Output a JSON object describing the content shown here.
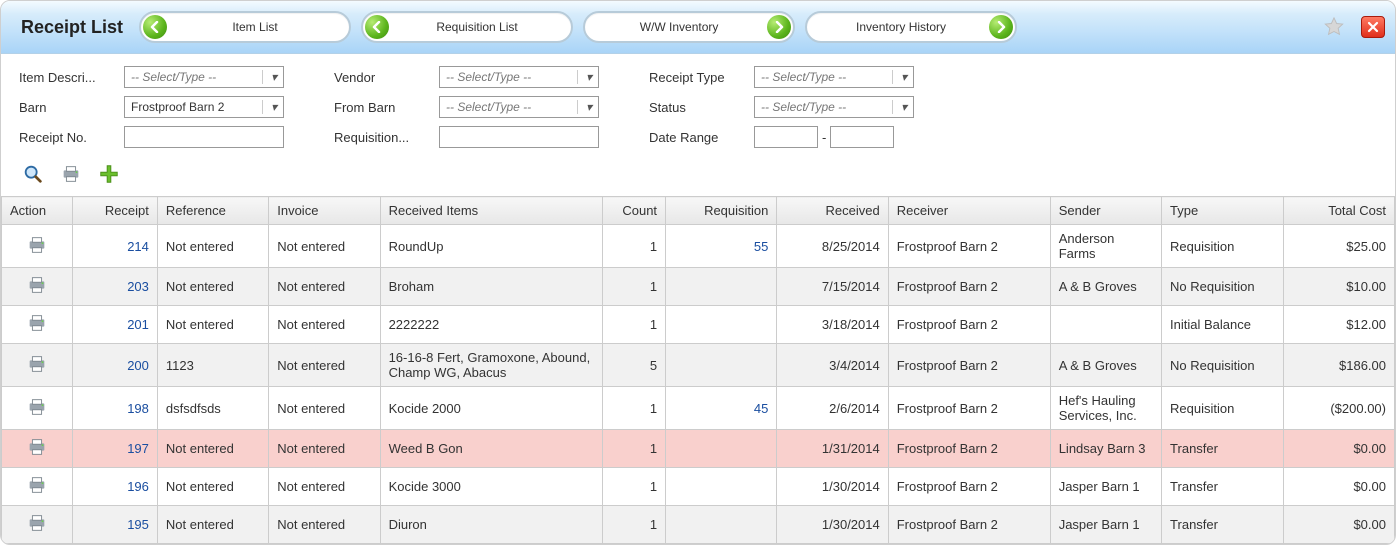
{
  "title": "Receipt List",
  "nav": {
    "item_list": "Item List",
    "requisition_list": "Requisition List",
    "ww_inventory": "W/W Inventory",
    "inventory_history": "Inventory History"
  },
  "filters": {
    "placeholder": "-- Select/Type --",
    "item_description": {
      "label": "Item Descri..."
    },
    "barn": {
      "label": "Barn",
      "value": "Frostproof Barn 2"
    },
    "receipt_no": {
      "label": "Receipt No."
    },
    "vendor": {
      "label": "Vendor"
    },
    "from_barn": {
      "label": "From Barn"
    },
    "requisition": {
      "label": "Requisition..."
    },
    "receipt_type": {
      "label": "Receipt Type"
    },
    "status": {
      "label": "Status"
    },
    "date_range": {
      "label": "Date Range",
      "sep": "-"
    }
  },
  "columns": {
    "action": "Action",
    "receipt": "Receipt",
    "reference": "Reference",
    "invoice": "Invoice",
    "items": "Received Items",
    "count": "Count",
    "requisition": "Requisition",
    "received": "Received",
    "receiver": "Receiver",
    "sender": "Sender",
    "type": "Type",
    "total_cost": "Total Cost"
  },
  "rows": [
    {
      "receipt": "214",
      "reference": "Not entered",
      "invoice": "Not entered",
      "items": "RoundUp",
      "count": "1",
      "requisition": "55",
      "received": "8/25/2014",
      "receiver": "Frostproof Barn 2",
      "sender": "Anderson Farms",
      "type": "Requisition",
      "cost": "$25.00",
      "striped": false,
      "highlight": false
    },
    {
      "receipt": "203",
      "reference": "Not entered",
      "invoice": "Not entered",
      "items": "Broham",
      "count": "1",
      "requisition": "",
      "received": "7/15/2014",
      "receiver": "Frostproof Barn 2",
      "sender": "A & B Groves",
      "type": "No Requisition",
      "cost": "$10.00",
      "striped": true,
      "highlight": false
    },
    {
      "receipt": "201",
      "reference": "Not entered",
      "invoice": "Not entered",
      "items": "2222222",
      "count": "1",
      "requisition": "",
      "received": "3/18/2014",
      "receiver": "Frostproof Barn 2",
      "sender": "",
      "type": "Initial Balance",
      "cost": "$12.00",
      "striped": false,
      "highlight": false
    },
    {
      "receipt": "200",
      "reference": "1123",
      "invoice": "Not entered",
      "items": "16-16-8 Fert, Gramoxone, Abound, Champ WG, Abacus",
      "count": "5",
      "requisition": "",
      "received": "3/4/2014",
      "receiver": "Frostproof Barn 2",
      "sender": "A & B Groves",
      "type": "No Requisition",
      "cost": "$186.00",
      "striped": true,
      "highlight": false
    },
    {
      "receipt": "198",
      "reference": "dsfsdfsds",
      "invoice": "Not entered",
      "items": "Kocide 2000",
      "count": "1",
      "requisition": "45",
      "received": "2/6/2014",
      "receiver": "Frostproof Barn 2",
      "sender": "Hef's Hauling Services, Inc.",
      "type": "Requisition",
      "cost": "($200.00)",
      "striped": false,
      "highlight": false
    },
    {
      "receipt": "197",
      "reference": "Not entered",
      "invoice": "Not entered",
      "items": "Weed B Gon",
      "count": "1",
      "requisition": "",
      "received": "1/31/2014",
      "receiver": "Frostproof Barn 2",
      "sender": "Lindsay Barn 3",
      "type": "Transfer",
      "cost": "$0.00",
      "striped": true,
      "highlight": true
    },
    {
      "receipt": "196",
      "reference": "Not entered",
      "invoice": "Not entered",
      "items": "Kocide 3000",
      "count": "1",
      "requisition": "",
      "received": "1/30/2014",
      "receiver": "Frostproof Barn 2",
      "sender": "Jasper Barn 1",
      "type": "Transfer",
      "cost": "$0.00",
      "striped": false,
      "highlight": false
    },
    {
      "receipt": "195",
      "reference": "Not entered",
      "invoice": "Not entered",
      "items": "Diuron",
      "count": "1",
      "requisition": "",
      "received": "1/30/2014",
      "receiver": "Frostproof Barn 2",
      "sender": "Jasper Barn 1",
      "type": "Transfer",
      "cost": "$0.00",
      "striped": true,
      "highlight": false
    }
  ]
}
